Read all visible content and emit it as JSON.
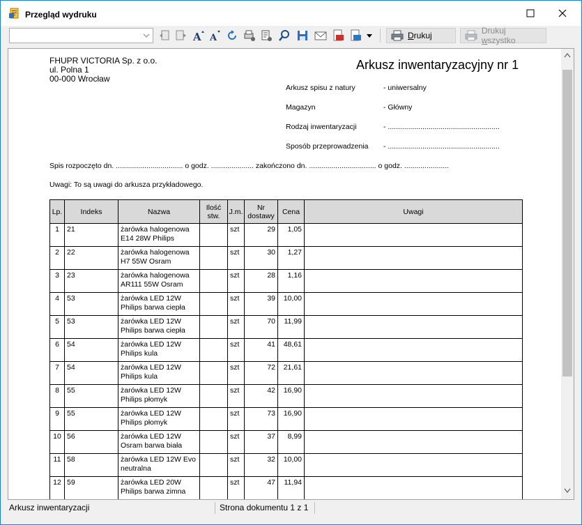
{
  "window": {
    "title": "Przegląd wydruku"
  },
  "toolbar": {
    "combo_value": "",
    "print_label_pre": "",
    "print_label_u": "D",
    "print_label_post": "rukuj",
    "print_all_label_pre": "Drukuj ",
    "print_all_label_u": "w",
    "print_all_label_post": "szystko",
    "icons": [
      "first-page-icon",
      "prev-page-icon",
      "font-increase-icon",
      "font-decrease-icon",
      "refresh-icon",
      "page-settings-icon",
      "print-settings-icon",
      "search-icon",
      "save-icon",
      "email-icon",
      "export-pdf-icon",
      "export-xls-icon"
    ]
  },
  "document": {
    "company": [
      "FHUPR VICTORIA Sp. z o.o.",
      "ul. Polna 1",
      "00-000 Wrocław"
    ],
    "title": "Arkusz inwentaryzacyjny nr 1",
    "meta": [
      {
        "label": "Arkusz spisu z natury",
        "value": "- uniwersalny"
      },
      {
        "label": "Magazyn",
        "value": "- Główny"
      },
      {
        "label": "Rodzaj inwentaryzacji",
        "value": "- ......................................................."
      },
      {
        "label": "Sposób przeprowadzenia",
        "value": "- ......................................................."
      }
    ],
    "start_line": "Spis rozpoczęto dn. ................................. o godz. ..................... zakończono dn. ................................. o godz. ......................",
    "remarks": "Uwagi: To są uwagi do arkusza przykładowego.",
    "table": {
      "headers": [
        "Lp.",
        "Indeks",
        "Nazwa",
        "Ilość\nstw.",
        "J.m.",
        "Nr\ndostawy",
        "Cena",
        "Uwagi"
      ],
      "rows": [
        {
          "lp": "1",
          "index": "21",
          "name1": "żarówka halogenowa",
          "name2": "E14 28W Philips",
          "qty": "",
          "unit": "szt",
          "delivery": "29",
          "price": "1,05",
          "notes": ""
        },
        {
          "lp": "2",
          "index": "22",
          "name1": "żarówka halogenowa",
          "name2": "H7 55W Osram",
          "qty": "",
          "unit": "szt",
          "delivery": "30",
          "price": "1,27",
          "notes": ""
        },
        {
          "lp": "3",
          "index": "23",
          "name1": "żarówka halogenowa",
          "name2": "AR111 55W Osram",
          "qty": "",
          "unit": "szt",
          "delivery": "28",
          "price": "1,16",
          "notes": ""
        },
        {
          "lp": "4",
          "index": "53",
          "name1": "żarówka LED 12W",
          "name2": "Philips barwa ciepła",
          "qty": "",
          "unit": "szt",
          "delivery": "39",
          "price": "10,00",
          "notes": ""
        },
        {
          "lp": "5",
          "index": "53",
          "name1": "żarówka LED 12W",
          "name2": "Philips barwa ciepła",
          "qty": "",
          "unit": "szt",
          "delivery": "70",
          "price": "11,99",
          "notes": ""
        },
        {
          "lp": "6",
          "index": "54",
          "name1": "żarówka LED 12W",
          "name2": "Philips kula",
          "qty": "",
          "unit": "szt",
          "delivery": "41",
          "price": "48,61",
          "notes": ""
        },
        {
          "lp": "7",
          "index": "54",
          "name1": "żarówka LED 12W",
          "name2": "Philips kula",
          "qty": "",
          "unit": "szt",
          "delivery": "72",
          "price": "21,61",
          "notes": ""
        },
        {
          "lp": "8",
          "index": "55",
          "name1": "żarówka LED 12W",
          "name2": "Philips płomyk",
          "qty": "",
          "unit": "szt",
          "delivery": "42",
          "price": "16,90",
          "notes": ""
        },
        {
          "lp": "9",
          "index": "55",
          "name1": "żarówka LED 12W",
          "name2": "Philips płomyk",
          "qty": "",
          "unit": "szt",
          "delivery": "73",
          "price": "16,90",
          "notes": ""
        },
        {
          "lp": "10",
          "index": "56",
          "name1": "żarówka LED 12W",
          "name2": "Osram barwa biała",
          "qty": "",
          "unit": "szt",
          "delivery": "37",
          "price": "8,99",
          "notes": ""
        },
        {
          "lp": "11",
          "index": "58",
          "name1": "żarówka LED 12W Evo",
          "name2": "neutralna",
          "qty": "",
          "unit": "szt",
          "delivery": "32",
          "price": "10,00",
          "notes": ""
        },
        {
          "lp": "12",
          "index": "59",
          "name1": "żarówka LED 20W",
          "name2": "Philips barwa zimna",
          "qty": "",
          "unit": "szt",
          "delivery": "47",
          "price": "11,94",
          "notes": ""
        }
      ]
    }
  },
  "status": {
    "left": "Arkusz inwentaryzacji",
    "middle": "Strona dokumentu 1 z 1"
  },
  "colors": {
    "window_border": "#1883d7",
    "header_fill": "#d9d9d9",
    "chrome": "#f0f0f0"
  }
}
